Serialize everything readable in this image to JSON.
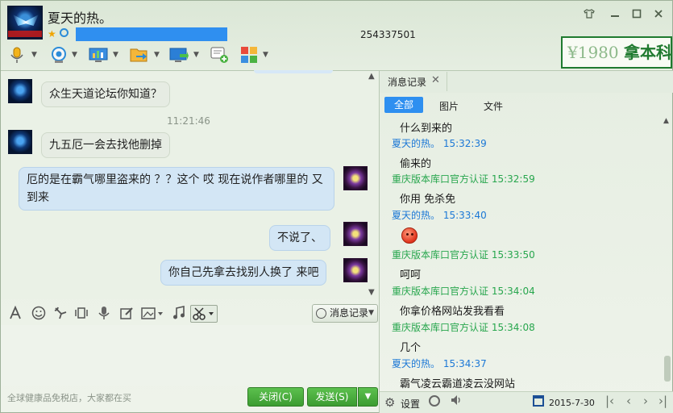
{
  "header": {
    "contact_name": "夏天的热。",
    "qq_number": "254337501",
    "brand": {
      "number": "1980",
      "text": "拿本科"
    }
  },
  "window_controls": {
    "skin_icon": "shirt-icon",
    "minimize_icon": "minimize-icon",
    "maximize_icon": "maximize-icon",
    "close_icon": "close-icon"
  },
  "toolbar": {
    "items": [
      "microphone-icon",
      "webcam-icon",
      "screen-share-icon",
      "send-file-icon",
      "remote-desktop-icon",
      "new-chat-icon",
      "apps-grid-icon"
    ]
  },
  "chat": {
    "timestamp": "11:21:46",
    "messages": [
      {
        "side": "left",
        "text": "众生天道论坛你知道？"
      },
      {
        "side": "left",
        "text": "九五厄一会去找他删掉"
      },
      {
        "side": "right",
        "text": "厄的是在霸气哪里盗来的 ？？这个 哎 现在说作者哪里的 又到来"
      },
      {
        "side": "right",
        "text": "不说了、"
      },
      {
        "side": "right",
        "text": "你自己先拿去找别人换了 来吧"
      }
    ]
  },
  "input_toolbar": {
    "icons": [
      "font-icon",
      "emoji-icon",
      "poke-icon",
      "shake-icon",
      "voice-icon",
      "doodle-icon",
      "image-icon",
      "music-icon",
      "screenshot-icon"
    ],
    "history_button": "消息记录"
  },
  "footer": {
    "ad_text": "全球健康品免税店，大家都在买",
    "close_button": "关闭(C)",
    "send_button": "发送(S)"
  },
  "history": {
    "tab_title": "消息记录",
    "filters": [
      "全部",
      "图片",
      "文件"
    ],
    "entries": [
      {
        "type": "msg",
        "text": "什么到来的"
      },
      {
        "type": "name",
        "color": "blue",
        "text": "夏天的热。 15:32:39"
      },
      {
        "type": "msg",
        "text": "偷来的"
      },
      {
        "type": "name",
        "color": "green",
        "text": "重庆版本库口官方认证 15:32:59"
      },
      {
        "type": "msg",
        "text": "你用 免杀免"
      },
      {
        "type": "name",
        "color": "blue",
        "text": "夏天的热。 15:33:40"
      },
      {
        "type": "emoji",
        "text": ""
      },
      {
        "type": "name",
        "color": "green",
        "text": "重庆版本库口官方认证 15:33:50"
      },
      {
        "type": "msg",
        "text": "呵呵"
      },
      {
        "type": "name",
        "color": "green",
        "text": "重庆版本库口官方认证 15:34:04"
      },
      {
        "type": "msg",
        "text": "你拿价格网站发我看看"
      },
      {
        "type": "name",
        "color": "green",
        "text": "重庆版本库口官方认证 15:34:08"
      },
      {
        "type": "msg",
        "text": "几个"
      },
      {
        "type": "name",
        "color": "blue",
        "text": "夏天的热。 15:34:37"
      },
      {
        "type": "msg",
        "text": "霸气凌云霸道凌云没网站"
      }
    ],
    "footer": {
      "settings_label": "设置",
      "date": "2015-7-30"
    }
  },
  "colors": {
    "accent_blue": "#2e8ff0",
    "name_blue": "#1c78d6",
    "name_green": "#27a64d",
    "button_green": "#3c9c31"
  }
}
